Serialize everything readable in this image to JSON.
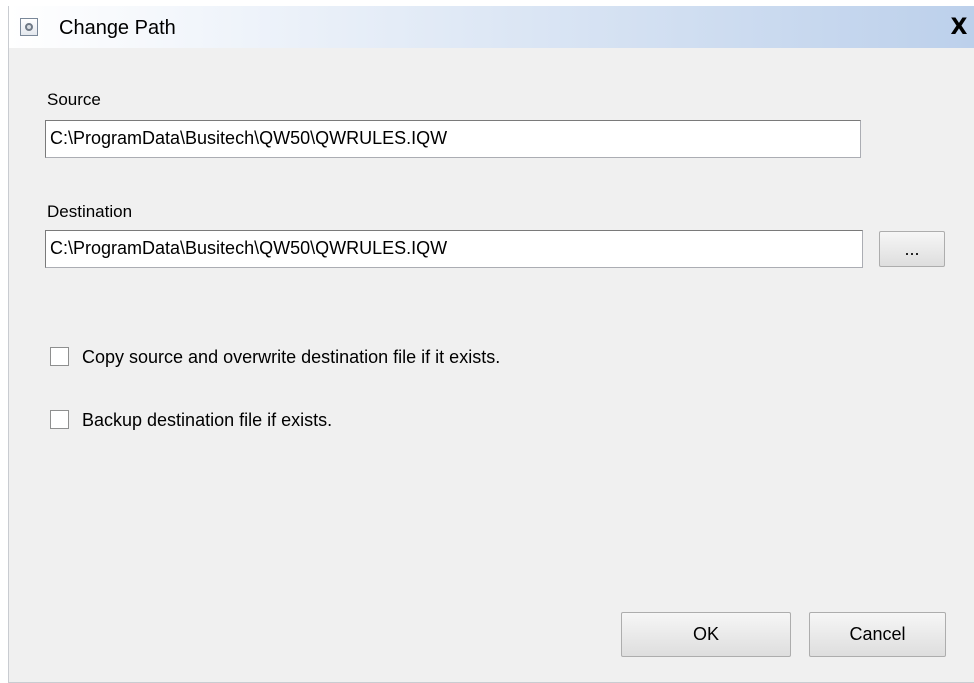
{
  "window": {
    "title": "Change Path",
    "close_glyph": "X",
    "title_icon": "gear-icon",
    "close_icon": "close-icon"
  },
  "source": {
    "label": "Source",
    "value": "C:\\ProgramData\\Busitech\\QW50\\QWRULES.IQW"
  },
  "destination": {
    "label": "Destination",
    "value": "C:\\ProgramData\\Busitech\\QW50\\QWRULES.IQW",
    "browse_label": "..."
  },
  "options": {
    "copy_overwrite": {
      "label": "Copy source and overwrite destination file if it exists.",
      "checked": false
    },
    "backup": {
      "label": "Backup destination file if exists.",
      "checked": false
    }
  },
  "buttons": {
    "ok_label": "OK",
    "cancel_label": "Cancel"
  },
  "colors": {
    "titlebar_end": "#bcd0eb",
    "window_bg": "#f0f0f0"
  }
}
